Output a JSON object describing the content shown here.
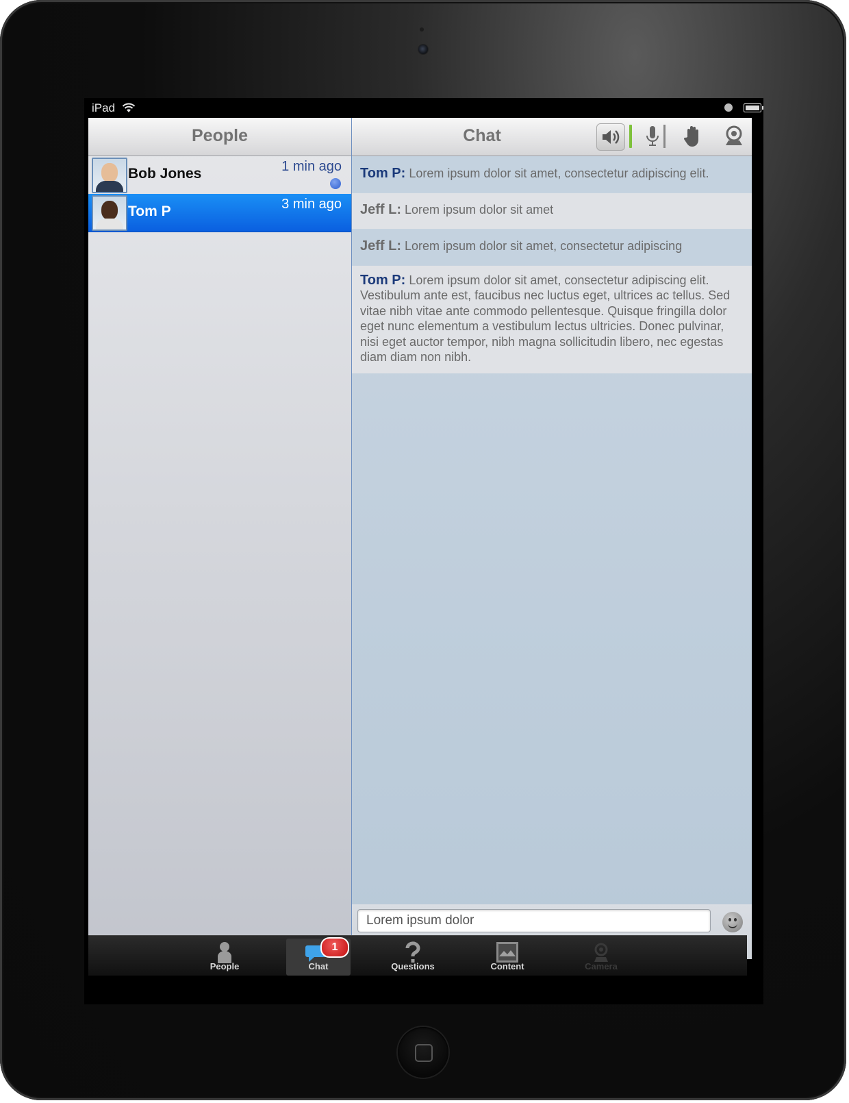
{
  "status_bar": {
    "carrier": "iPad"
  },
  "people_pane": {
    "title": "People",
    "people": [
      {
        "name": "Bob Jones",
        "time": "1 min ago",
        "unread": true
      },
      {
        "name": "Tom P",
        "time": "3 min ago",
        "selected": true
      }
    ]
  },
  "chat_pane": {
    "title": "Chat",
    "messages": [
      {
        "sender": "Tom P:",
        "text": "Lorem ipsum dolor sit amet, consectetur adipiscing elit."
      },
      {
        "sender": "Jeff L:",
        "text": "Lorem ipsum dolor sit amet"
      },
      {
        "sender": "Jeff L:",
        "text": "Lorem ipsum dolor sit amet, consectetur adipiscing"
      },
      {
        "sender": "Tom P:",
        "text": "Lorem ipsum dolor sit amet, consectetur adipiscing elit. Vestibulum ante est, faucibus nec luctus eget, ultrices ac tellus. Sed vitae nibh vitae ante commodo pellentesque. Quisque fringilla dolor eget nunc elementum a vestibulum lectus ultricies. Donec pulvinar, nisi eget auctor tempor, nibh magna sollicitudin libero, nec egestas diam diam non nibh."
      }
    ],
    "input_value": "Lorem ipsum dolor"
  },
  "tab_bar": {
    "tabs": [
      {
        "label": "People",
        "icon": "person-icon"
      },
      {
        "label": "Chat",
        "icon": "chat-bubble-icon",
        "active": true,
        "badge": "1"
      },
      {
        "label": "Questions",
        "icon": "question-mark-icon"
      },
      {
        "label": "Content",
        "icon": "picture-icon"
      },
      {
        "label": "Camera",
        "icon": "webcam-icon",
        "disabled": true
      }
    ]
  },
  "colors": {
    "selected_row": "#0a6fe8",
    "sender_blue": "#1b3a7a",
    "speaker_level": "#7ec13b",
    "badge_red": "#d61c1c"
  }
}
